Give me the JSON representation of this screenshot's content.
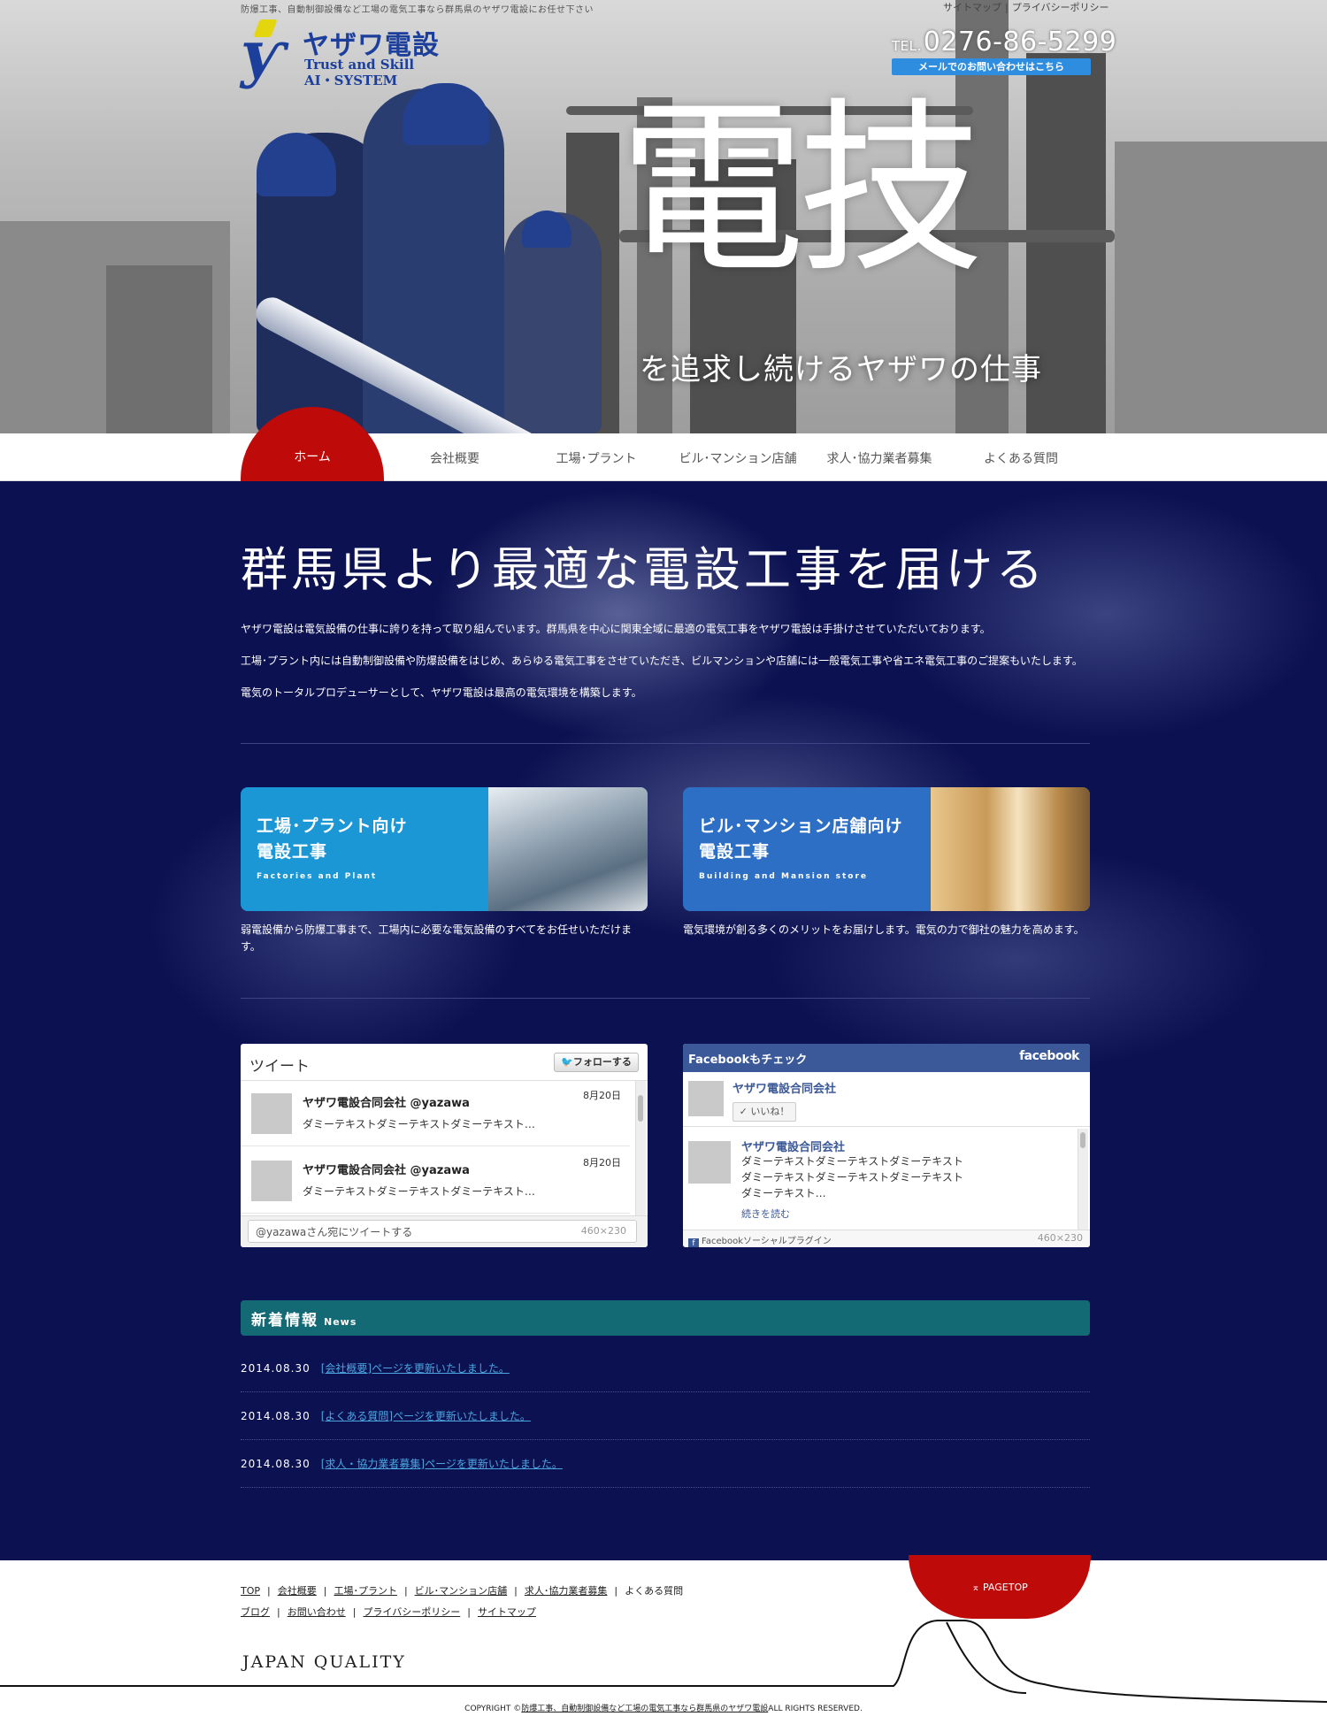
{
  "header": {
    "tagline": "防爆工事、自動制御設備など工場の電気工事なら群馬県のヤザワ電設にお任せ下さい",
    "top_links": [
      "サイトマップ",
      "プライバシーポリシー"
    ],
    "logo": {
      "name": "ヤザワ電設",
      "line1": "Trust and Skill",
      "line2": "AI・SYSTEM"
    },
    "tel_prefix": "TEL.",
    "tel": "0276-86-5299",
    "mail_button": "メールでのお問い合わせはこちら",
    "hero_title": "電技",
    "hero_subtitle": "を追求し続けるヤザワの仕事"
  },
  "nav": {
    "items": [
      "ホーム",
      "会社概要",
      "工場･プラント",
      "ビル･マンション店舗",
      "求人･協力業者募集",
      "よくある質問"
    ],
    "active_color": "#bf0a0a"
  },
  "intro": {
    "heading": "群馬県より最適な電設工事を届ける",
    "paragraphs": [
      "ヤザワ電設は電気設備の仕事に誇りを持って取り組んでいます。群馬県を中心に関東全域に最適の電気工事をヤザワ電設は手掛けさせていただいております。",
      "工場･プラント内には自動制御設備や防爆設備をはじめ、あらゆる電気工事をさせていただき、ビルマンションや店舗には一般電気工事や省エネ電気工事のご提案もいたします。",
      "電気のトータルプロデューサーとして、ヤザワ電設は最高の電気環境を構築します。"
    ]
  },
  "cards": [
    {
      "title1": "工場･プラント向け",
      "title2": "電設工事",
      "en": "Factories and Plant",
      "color": "#1c97d6",
      "desc": "弱電設備から防爆工事まで、工場内に必要な電気設備のすべてをお任せいただけます。"
    },
    {
      "title1": "ビル･マンション店舗向け",
      "title2": "電設工事",
      "en": "Building and Mansion store",
      "color": "#2e6fc6",
      "desc": "電気環境が創る多くのメリットをお届けします。電気の力で御社の魅力を高めます。"
    }
  ],
  "twitter": {
    "title": "ツイート",
    "follow": "フォローする",
    "tweets": [
      {
        "name": "ヤザワ電設合同会社 @yazawa",
        "date": "8月20日",
        "text": "ダミーテキストダミーテキストダミーテキスト…"
      },
      {
        "name": "ヤザワ電設合同会社 @yazawa",
        "date": "8月20日",
        "text": "ダミーテキストダミーテキストダミーテキスト…"
      }
    ],
    "input_placeholder": "@yazawaさん宛にツイートする",
    "size": "460×230"
  },
  "facebook": {
    "title": "Facebookもチェック",
    "logo": "facebook",
    "page_name": "ヤザワ電設合同会社",
    "like": "いいね！",
    "post_name": "ヤザワ電設合同会社",
    "post_lines": [
      "ダミーテキストダミーテキストダミーテキスト",
      "ダミーテキストダミーテキストダミーテキスト",
      "ダミーテキスト…"
    ],
    "more": "続きを読む",
    "footer": "Facebookソーシャルプラグイン",
    "size": "460×230"
  },
  "news": {
    "title": "新着情報",
    "title_en": "News",
    "items": [
      {
        "date": "2014.08.30",
        "text": "[会社概要]ページを更新いたしました。"
      },
      {
        "date": "2014.08.30",
        "text": "[よくある質問]ページを更新いたしました。"
      },
      {
        "date": "2014.08.30",
        "text": "[求人・協力業者募集]ページを更新いたしました。"
      }
    ]
  },
  "footer": {
    "links_row1": [
      "TOP",
      "会社概要",
      "工場･プラント",
      "ビル･マンション店舗",
      "求人･協力業者募集",
      "よくある質問"
    ],
    "links_row2": [
      "ブログ",
      "お問い合わせ",
      "プライバシーポリシー",
      "サイトマップ"
    ],
    "pagetop": "PAGETOP",
    "japan_quality": "JAPAN QUALITY",
    "copyright_prefix": "COPYRIGHT ©",
    "copyright_link": "防爆工事、自動制御設備など工場の電気工事なら群馬県のヤザワ電設",
    "copyright_suffix": "ALL RIGHTS RESERVED."
  }
}
